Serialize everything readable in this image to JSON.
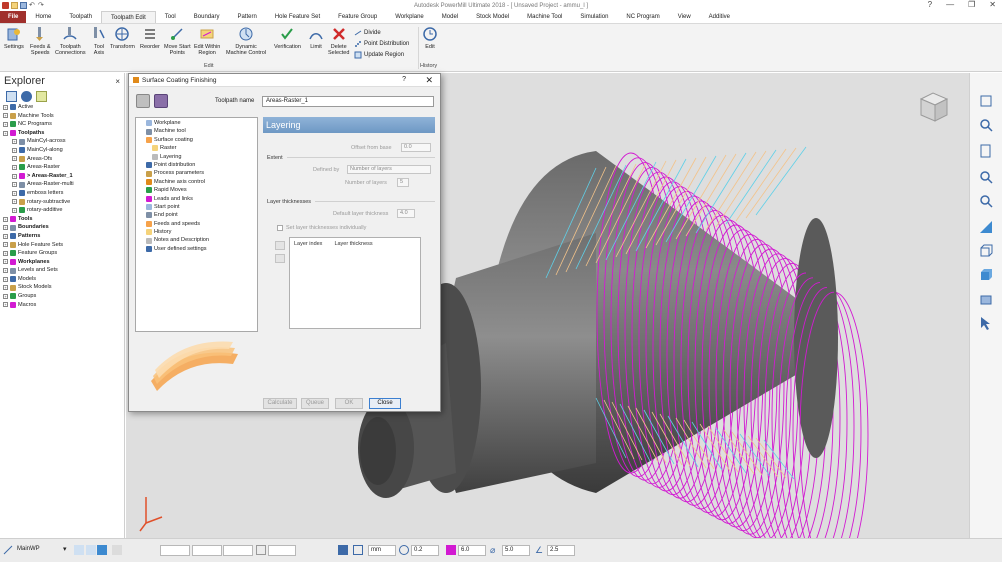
{
  "window": {
    "title": "Autodesk PowerMill Ultimate 2018  -  [ Unsaved Project - ammu_l ]",
    "help": "?",
    "minimize": "—",
    "restore": "❐",
    "close": "✕"
  },
  "ribbon_tabs": [
    "File",
    "Home",
    "Toolpath",
    "Toolpath Edit",
    "Tool",
    "Boundary",
    "Pattern",
    "Hole Feature Set",
    "Feature Group",
    "Workplane",
    "Model",
    "Stock Model",
    "Machine Tool",
    "Simulation",
    "NC Program",
    "View",
    "Additive"
  ],
  "ribbon": {
    "buttons": [
      {
        "label": "Settings"
      },
      {
        "label": "Feeds &\nSpeeds"
      },
      {
        "label": "Toolpath\nConnections"
      },
      {
        "label": "Tool\nAxis"
      },
      {
        "label": "Transform"
      },
      {
        "label": "Reorder"
      },
      {
        "label": "Move Start\nPoints"
      },
      {
        "label": "Edit Within\nRegion"
      },
      {
        "label": "Dynamic\nMachine Control"
      },
      {
        "label": "Verification"
      },
      {
        "label": "Limit"
      },
      {
        "label": "Delete\nSelected"
      },
      {
        "label": "Edit"
      }
    ],
    "small_buttons": [
      "Divide",
      "Point Distribution",
      "Update Region"
    ],
    "groups": [
      "Edit",
      "History"
    ]
  },
  "explorer": {
    "title": "Explorer",
    "close": "×",
    "tree": [
      {
        "label": "Active",
        "bold": false,
        "indent": 0
      },
      {
        "label": "Machine Tools",
        "bold": false,
        "indent": 0
      },
      {
        "label": "NC Programs",
        "bold": false,
        "indent": 0
      },
      {
        "label": "Toolpaths",
        "bold": true,
        "indent": 0
      },
      {
        "label": "MainCyl-across",
        "bold": false,
        "indent": 1
      },
      {
        "label": "MainCyl-along",
        "bold": false,
        "indent": 1
      },
      {
        "label": "Areas-Ofs",
        "bold": false,
        "indent": 1
      },
      {
        "label": "Areas-Raster",
        "bold": false,
        "indent": 1
      },
      {
        "label": "> Areas-Raster_1",
        "bold": true,
        "indent": 1
      },
      {
        "label": "Areas-Raster-multi",
        "bold": false,
        "indent": 1
      },
      {
        "label": "emboss letters",
        "bold": false,
        "indent": 1
      },
      {
        "label": "rotary-subtractive",
        "bold": false,
        "indent": 1
      },
      {
        "label": "rotary-additive",
        "bold": false,
        "indent": 1
      },
      {
        "label": "Tools",
        "bold": true,
        "indent": 0
      },
      {
        "label": "Boundaries",
        "bold": true,
        "indent": 0
      },
      {
        "label": "Patterns",
        "bold": true,
        "indent": 0
      },
      {
        "label": "Hole Feature Sets",
        "bold": false,
        "indent": 0
      },
      {
        "label": "Feature Groups",
        "bold": false,
        "indent": 0
      },
      {
        "label": "Workplanes",
        "bold": true,
        "indent": 0
      },
      {
        "label": "Levels and Sets",
        "bold": false,
        "indent": 0
      },
      {
        "label": "Models",
        "bold": false,
        "indent": 0
      },
      {
        "label": "Stock Models",
        "bold": false,
        "indent": 0
      },
      {
        "label": "Groups",
        "bold": false,
        "indent": 0
      },
      {
        "label": "Macros",
        "bold": false,
        "indent": 0
      }
    ]
  },
  "dialog": {
    "title": "Surface Coating Finishing",
    "help": "?",
    "close": "✕",
    "toolpath_name_label": "Toolpath name",
    "toolpath_name_value": "Areas-Raster_1",
    "tree": [
      {
        "label": "Workplane",
        "indent": 1
      },
      {
        "label": "Machine tool",
        "indent": 1
      },
      {
        "label": "Surface coating",
        "indent": 1
      },
      {
        "label": "Raster",
        "indent": 2
      },
      {
        "label": "Layering",
        "indent": 2
      },
      {
        "label": "Point distribution",
        "indent": 1
      },
      {
        "label": "Process parameters",
        "indent": 1
      },
      {
        "label": "Machine axis control",
        "indent": 1
      },
      {
        "label": "Rapid Moves",
        "indent": 1
      },
      {
        "label": "Leads and links",
        "indent": 1
      },
      {
        "label": "Start point",
        "indent": 1
      },
      {
        "label": "End point",
        "indent": 1
      },
      {
        "label": "Feeds and speeds",
        "indent": 1
      },
      {
        "label": "History",
        "indent": 1
      },
      {
        "label": "Notes and Description",
        "indent": 1
      },
      {
        "label": "User defined settings",
        "indent": 1
      }
    ],
    "pane_title": "Layering",
    "offset_label": "Offset from base",
    "offset_value": "0.0",
    "extent_label": "Extent",
    "defined_by_label": "Defined by",
    "defined_by_value": "Number of layers",
    "num_layers_label": "Number of layers",
    "num_layers_value": "5",
    "layer_thickness_label": "Layer thicknesses",
    "default_thickness_label": "Default layer thickness",
    "default_thickness_value": "4.0",
    "set_individually_label": "Set layer thicknesses individually",
    "list_col1": "Layer index",
    "list_col2": "Layer thickness",
    "buttons": {
      "calculate": "Calculate",
      "queue": "Queue",
      "ok": "OK",
      "close": "Close"
    }
  },
  "statusbar": {
    "workplane": "MainWP",
    "units": "mm",
    "tolerance": "0.2",
    "stepover": "6.0",
    "diameter": "5.0",
    "angle": "2.5"
  },
  "colors": {
    "toolpath": "#d21ad2",
    "cylinder": "#5a5a5a",
    "accent": "#6e98c4",
    "file_tab": "#a0302c"
  }
}
